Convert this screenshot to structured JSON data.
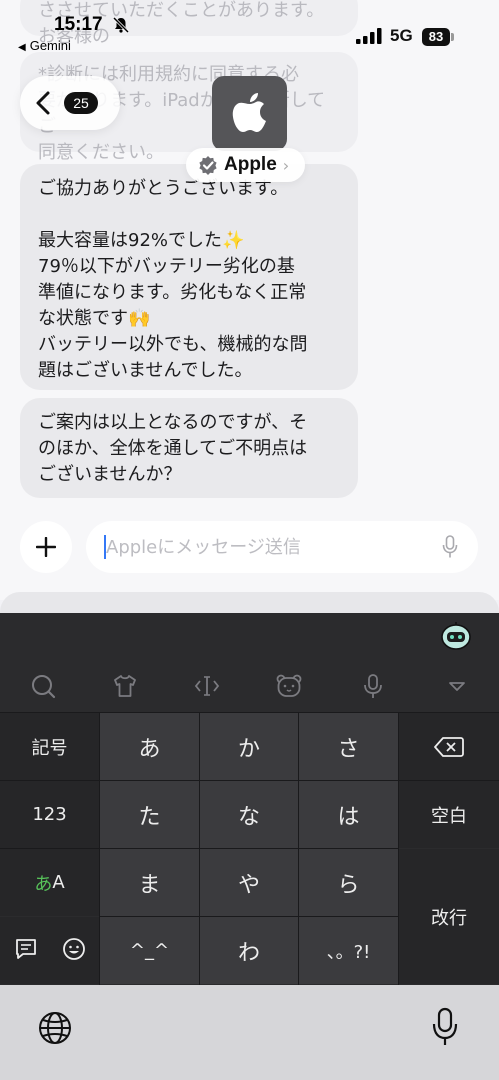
{
  "status_bar": {
    "time": "15:17",
    "back_app": "Gemini",
    "network": "5G",
    "battery": "83"
  },
  "header": {
    "unread_count": "25",
    "contact_name": "Apple"
  },
  "messages": [
    {
      "text": "ささせていただくことがあります。お客様の\n果を確認させていただきます。",
      "faded": true
    },
    {
      "text": "*診断には利用規約に同意する必\n要があります。iPadからも診断してご\n同意ください。",
      "faded": true
    },
    {
      "text": "ご協力ありがとうございます。\n\n最大容量は92%でした✨\n79％以下がバッテリー劣化の基\n準値になります。劣化もなく正常\nな状態です🙌\nバッテリー以外でも、機械的な問\n題はございませんでした。",
      "faded": false
    },
    {
      "text": "ご案内は以上となるのですが、そ\nのほか、全体を通してご不明点は\nございませんか？",
      "faded": false
    }
  ],
  "composer": {
    "placeholder": "Appleにメッセージ送信"
  },
  "keyboard": {
    "toolbar_icons": [
      "search-icon",
      "shirt-icon",
      "cursor-icon",
      "bear-face-icon",
      "mic-icon",
      "hide-keyboard-icon"
    ],
    "left_keys": [
      "記号",
      "123",
      "あA"
    ],
    "grid_keys": [
      [
        "あ",
        "か",
        "さ"
      ],
      [
        "た",
        "な",
        "は"
      ],
      [
        "ま",
        "や",
        "ら"
      ],
      [
        "^_^",
        "わ",
        "、。?!"
      ]
    ],
    "right_keys": [
      "delete",
      "空白",
      "改行"
    ],
    "bottom_left_icons": [
      "memo-icon",
      "emoji-icon"
    ],
    "colors": {
      "key_bg": "#3b3b3e",
      "side_bg": "#262628",
      "accent_green": "#57c25a"
    }
  }
}
